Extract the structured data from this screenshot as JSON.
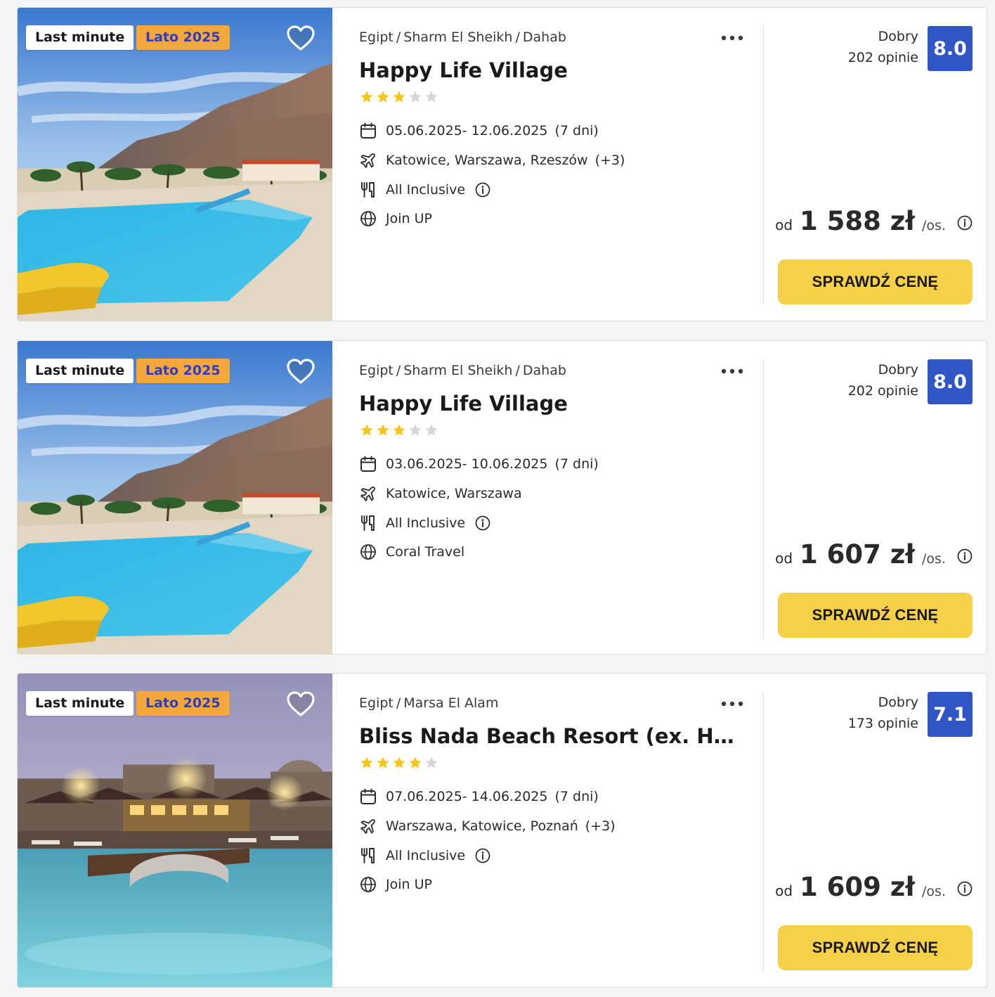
{
  "colors": {
    "badge_season_bg": "#f5a83a",
    "badge_season_text": "#2e3bc2",
    "rating_bg": "#2f56c4",
    "cta_bg": "#f6d046",
    "star_filled": "#f5c518",
    "star_empty": "#d6d6d6"
  },
  "icons": {
    "favorite": "heart-outline-icon",
    "more": "more-dots-icon",
    "dates": "calendar-icon",
    "airports": "airplane-icon",
    "board": "fork-knife-icon",
    "operator": "globe-icon",
    "info": "info-circle-icon"
  },
  "offers": [
    {
      "badges": {
        "last_minute": "Last minute",
        "season": "Lato 2025"
      },
      "location": [
        "Egipt",
        "Sharm El Sheikh",
        "Dahab"
      ],
      "separator": "/",
      "name": "Happy Life Village",
      "stars": 3,
      "dates": "05.06.2025- 12.06.2025",
      "duration": "(7 dni)",
      "airports": "Katowice, Warszawa, Rzeszów",
      "airports_more": "(+3)",
      "board": "All Inclusive",
      "operator": "Join UP",
      "rating_word": "Dobry",
      "reviews": "202 opinie",
      "rating": "8.0",
      "price_prefix": "od",
      "price": "1 588 zł",
      "price_suffix": "/os.",
      "cta": "SPRAWDŹ CENĘ",
      "photo": "desert-pool"
    },
    {
      "badges": {
        "last_minute": "Last minute",
        "season": "Lato 2025"
      },
      "location": [
        "Egipt",
        "Sharm El Sheikh",
        "Dahab"
      ],
      "separator": "/",
      "name": "Happy Life Village",
      "stars": 3,
      "dates": "03.06.2025- 10.06.2025",
      "duration": "(7 dni)",
      "airports": "Katowice, Warszawa",
      "airports_more": "",
      "board": "All Inclusive",
      "operator": "Coral Travel",
      "rating_word": "Dobry",
      "reviews": "202 opinie",
      "rating": "8.0",
      "price_prefix": "od",
      "price": "1 607 zł",
      "price_suffix": "/os.",
      "cta": "SPRAWDŹ CENĘ",
      "photo": "desert-pool"
    },
    {
      "badges": {
        "last_minute": "Last minute",
        "season": "Lato 2025"
      },
      "location": [
        "Egipt",
        "Marsa El Alam"
      ],
      "separator": "/",
      "name": "Bliss Nada Beach Resort (ex. Hotelux Marsa Alam Resort)",
      "stars": 4,
      "dates": "07.06.2025- 14.06.2025",
      "duration": "(7 dni)",
      "airports": "Warszawa, Katowice, Poznań",
      "airports_more": "(+3)",
      "board": "All Inclusive",
      "operator": "Join UP",
      "rating_word": "Dobry",
      "reviews": "173 opinie",
      "rating": "7.1",
      "price_prefix": "od",
      "price": "1 609 zł",
      "price_suffix": "/os.",
      "cta": "SPRAWDŹ CENĘ",
      "photo": "night-resort"
    }
  ]
}
